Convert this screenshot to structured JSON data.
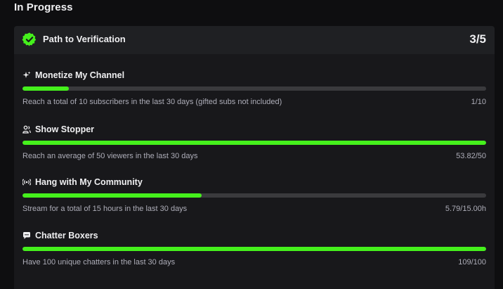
{
  "section": {
    "title": "In Progress"
  },
  "card": {
    "title": "Path to Verification",
    "count": "3/5",
    "badge_icon": "verified-badge-icon",
    "accent_color": "#45f01c"
  },
  "goals": [
    {
      "title": "Monetize My Channel",
      "icon": "sparkle-icon",
      "description": "Reach a total of 10 subscribers in the last 30 days (gifted subs not included)",
      "value": "1/10",
      "progress": 0.1
    },
    {
      "title": "Show Stopper",
      "icon": "viewers-icon",
      "description": "Reach an average of 50 viewers in the last 30 days",
      "value": "53.82/50",
      "progress": 1.0
    },
    {
      "title": "Hang with My Community",
      "icon": "broadcast-icon",
      "description": "Stream for a total of 15 hours in the last 30 days",
      "value": "5.79/15.00h",
      "progress": 0.386
    },
    {
      "title": "Chatter Boxers",
      "icon": "chat-bubble-icon",
      "description": "Have 100 unique chatters in the last 30 days",
      "value": "109/100",
      "progress": 1.0
    }
  ]
}
